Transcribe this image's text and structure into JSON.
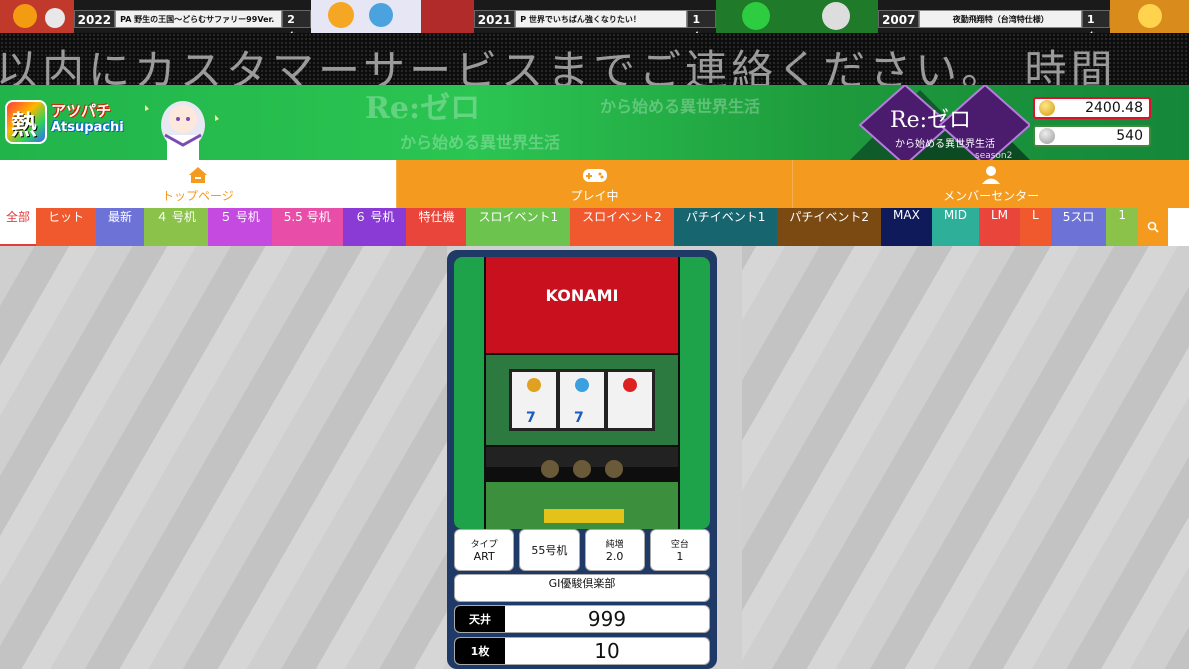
{
  "ticker": [
    {
      "year": "2022",
      "name": "PA 野生の王国～どらむサファリー99Ver.",
      "count": "2台"
    },
    {
      "year": "2021",
      "name": "P 世界でいちばん強くなりたい！",
      "count": "1台"
    },
    {
      "year": "2007",
      "name": "夜勤飛翔特（台湾特仕様）",
      "count": "1台"
    }
  ],
  "marquee": "以内にカスタマーサービスまでご連絡ください。 時間",
  "brand": {
    "logo_glyph": "熱",
    "name_jp": "アツパチ",
    "name_en": "Atsupachi"
  },
  "banner": {
    "title": "Re:ゼロ",
    "subtitle": "から始める異世界生活",
    "season": "season2"
  },
  "balance": {
    "gold": "2400.48",
    "silver": "540"
  },
  "mainnav": [
    {
      "label": "トップページ",
      "icon": "home-icon"
    },
    {
      "label": "プレイ中",
      "icon": "gamepad-icon"
    },
    {
      "label": "メンバーセンター",
      "icon": "user-icon"
    }
  ],
  "categories": [
    {
      "label": "全部",
      "color": "#ffffff"
    },
    {
      "label": "ヒット",
      "color": "#f0582e"
    },
    {
      "label": "最新",
      "color": "#6d73d6"
    },
    {
      "label": "４ 号机",
      "color": "#8bc34a"
    },
    {
      "label": "５ 号机",
      "color": "#c44ae0"
    },
    {
      "label": "5.5 号机",
      "color": "#e84ea8"
    },
    {
      "label": "６ 号机",
      "color": "#8a3bd6"
    },
    {
      "label": "特仕機",
      "color": "#e9453a"
    },
    {
      "label": "スロイベント1",
      "color": "#6cc34e"
    },
    {
      "label": "スロイベント2",
      "color": "#f0582e"
    },
    {
      "label": "パチイベント1",
      "color": "#17656e"
    },
    {
      "label": "パチイベント2",
      "color": "#7a4a12"
    },
    {
      "label": "MAX",
      "color": "#0f1a5a"
    },
    {
      "label": "MID",
      "color": "#2eaf9a"
    },
    {
      "label": "LM",
      "color": "#e9453a"
    },
    {
      "label": "L",
      "color": "#f0582e"
    },
    {
      "label": "5スロ",
      "color": "#6d73d6"
    },
    {
      "label": "1",
      "color": "#8bc34a"
    }
  ],
  "machine": {
    "maker": "KONAMI",
    "type_label": "タイプ",
    "type_value": "ART",
    "spec": "55号机",
    "rate_label": "純増",
    "rate_value": "2.0",
    "free_label": "空台",
    "free_value": "1",
    "name": "GI優駿倶楽部",
    "ceiling_label": "天井",
    "ceiling_value": "999",
    "per_label": "1枚",
    "per_value": "10"
  }
}
